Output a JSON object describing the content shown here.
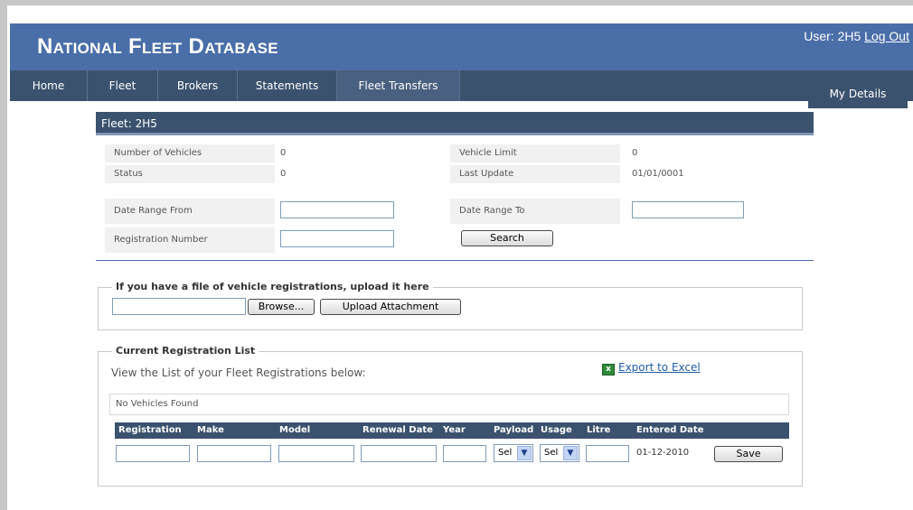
{
  "header": {
    "title": "National Fleet Database",
    "user_label": "User: 2H5",
    "logout_label": "Log Out"
  },
  "nav": {
    "items": [
      {
        "label": "Home"
      },
      {
        "label": "Fleet"
      },
      {
        "label": "Brokers"
      },
      {
        "label": "Statements"
      },
      {
        "label": "Fleet Transfers"
      }
    ],
    "my_details": "My Details"
  },
  "fleet": {
    "title": "Fleet: 2H5",
    "num_vehicles_label": "Number of Vehicles",
    "num_vehicles_value": "0",
    "vehicle_limit_label": "Vehicle Limit",
    "vehicle_limit_value": "0",
    "status_label": "Status",
    "status_value": "0",
    "last_update_label": "Last Update",
    "last_update_value": "01/01/0001",
    "date_from_label": "Date Range From",
    "date_from_value": "",
    "date_to_label": "Date Range To",
    "date_to_value": "",
    "reg_number_label": "Registration Number",
    "reg_number_value": "",
    "search_label": "Search"
  },
  "upload": {
    "legend": "If you have a file of vehicle registrations, upload it here",
    "file_value": "",
    "browse_label": "Browse...",
    "upload_label": "Upload Attachment"
  },
  "registration": {
    "legend": "Current Registration List",
    "intro": "View the List of your Fleet Registrations below:",
    "export_label": "Export to Excel",
    "empty_message": "No Vehicles Found",
    "columns": [
      "Registration",
      "Make",
      "Model",
      "Renewal Date",
      "Year",
      "Payload",
      "Usage",
      "Litre",
      "Entered Date"
    ],
    "new_row": {
      "registration": "",
      "make": "",
      "model": "",
      "renewal_date": "",
      "year": "",
      "payload": "Sel",
      "usage": "Sel",
      "litre": "",
      "entered_date": "01-12-2010",
      "save_label": "Save"
    }
  },
  "colors": {
    "header_blue": "#4a6ea8",
    "nav_dark": "#3b526e",
    "link_blue": "#1f5ea8"
  },
  "icons": {
    "excel": "excel-icon",
    "dropdown": "chevron-down-icon"
  }
}
